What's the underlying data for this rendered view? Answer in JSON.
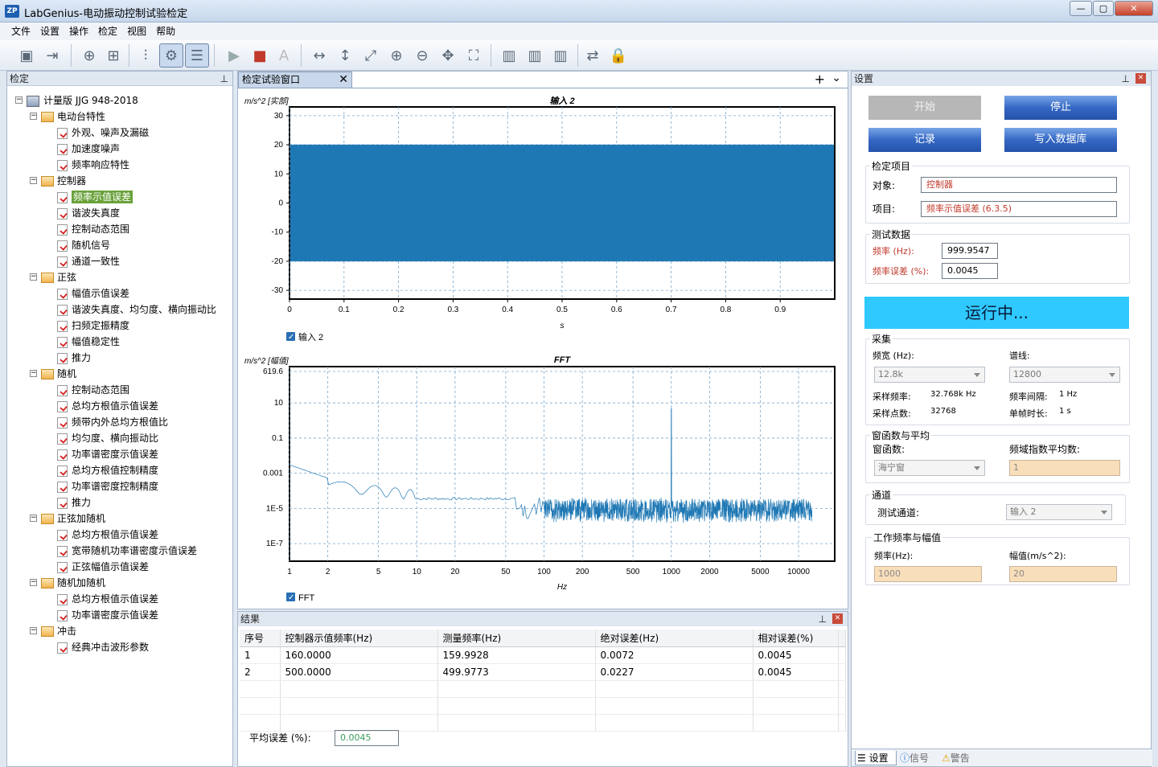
{
  "window": {
    "title": "LabGenius-电动振动控制试验检定",
    "logo": "ZP"
  },
  "menu": [
    "文件",
    "设置",
    "操作",
    "检定",
    "视图",
    "帮助"
  ],
  "left_panel": {
    "title": "检定",
    "root": "计量版 JJG 948-2018",
    "groups": [
      {
        "label": "电动台特性",
        "items": [
          "外观、噪声及漏磁",
          "加速度噪声",
          "频率响应特性"
        ]
      },
      {
        "label": "控制器",
        "items": [
          "频率示值误差",
          "谐波失真度",
          "控制动态范围",
          "随机信号",
          "通道一致性"
        ]
      },
      {
        "label": "正弦",
        "items": [
          "幅值示值误差",
          "谐波失真度、均匀度、横向振动比",
          "扫频定振精度",
          "幅值稳定性",
          "推力"
        ]
      },
      {
        "label": "随机",
        "items": [
          "控制动态范围",
          "总均方根值示值误差",
          "频带内外总均方根值比",
          "均匀度、横向振动比",
          "功率谱密度示值误差",
          "总均方根值控制精度",
          "功率谱密度控制精度",
          "推力"
        ]
      },
      {
        "label": "正弦加随机",
        "items": [
          "总均方根值示值误差",
          "宽带随机功率谱密度示值误差",
          "正弦幅值示值误差"
        ]
      },
      {
        "label": "随机加随机",
        "items": [
          "总均方根值示值误差",
          "功率谱密度示值误差"
        ]
      },
      {
        "label": "冲击",
        "items": [
          "经典冲击波形参数"
        ]
      }
    ],
    "selected": "频率示值误差"
  },
  "center": {
    "tab_label": "检定试验窗口",
    "add_symbol": "+",
    "menu_symbol": "⌄"
  },
  "chart_data": [
    {
      "type": "line",
      "title": "输入 2",
      "ylabel": "m/s^2 [实部]",
      "xlabel": "s",
      "xlim": [
        0,
        1
      ],
      "ylim": [
        -33,
        33
      ],
      "x_ticks": [
        "0",
        "0.1",
        "0.2",
        "0.3",
        "0.4",
        "0.5",
        "0.6",
        "0.7",
        "0.8",
        "0.9"
      ],
      "y_ticks": [
        "30",
        "20",
        "10",
        "0",
        "-10",
        "-20",
        "-30"
      ],
      "series": [
        {
          "name": "输入 2",
          "description_amplitude": 20,
          "frequency_hz": 160,
          "color": "#1f78b4"
        }
      ],
      "legend_checked": true
    },
    {
      "type": "line",
      "title": "FFT",
      "ylabel": "m/s^2 [幅值]",
      "xlabel": "Hz",
      "xscale": "log",
      "yscale": "log",
      "x_ticks": [
        "1",
        "2",
        "5",
        "10",
        "20",
        "50",
        "100",
        "200",
        "500",
        "1000",
        "2000",
        "5000",
        "10000"
      ],
      "y_ticks": [
        "619.6",
        "10",
        "0.1",
        "0.001",
        "1E-5",
        "1E-7"
      ],
      "series": [
        {
          "name": "FFT",
          "peak_hz": 1000,
          "color": "#1f78b4"
        }
      ],
      "legend_checked": true
    }
  ],
  "results": {
    "title": "结果",
    "columns": [
      "序号",
      "控制器示值频率(Hz)",
      "测量频率(Hz)",
      "绝对误差(Hz)",
      "相对误差(%)"
    ],
    "rows": [
      [
        "1",
        "160.0000",
        "159.9928",
        "0.0072",
        "0.0045"
      ],
      [
        "2",
        "500.0000",
        "499.9773",
        "0.0227",
        "0.0045"
      ]
    ],
    "avg_label": "平均误差 (%):",
    "avg_value": "0.0045"
  },
  "right_panel": {
    "title": "设置",
    "buttons": {
      "start": "开始",
      "stop": "停止",
      "record": "记录",
      "write_db": "写入数据库"
    },
    "verify": {
      "title": "检定项目",
      "object_label": "对象:",
      "object_value": "控制器",
      "item_label": "项目:",
      "item_value": "频率示值误差 (6.3.5)"
    },
    "test_data": {
      "title": "测试数据",
      "freq_label": "频率 (Hz):",
      "freq_value": "999.9547",
      "err_label": "频率误差 (%):",
      "err_value": "0.0045"
    },
    "status": "运行中...",
    "acq": {
      "title": "采集",
      "bw_label": "频宽 (Hz):",
      "bw_value": "12.8k",
      "lines_label": "谱线:",
      "lines_value": "12800",
      "sr_label": "采样频率:",
      "sr_value": "32.768k Hz",
      "fi_label": "频率间隔:",
      "fi_value": "1 Hz",
      "pts_label": "采样点数:",
      "pts_value": "32768",
      "frame_label": "单帧时长:",
      "frame_value": "1 s"
    },
    "window": {
      "title": "窗函数与平均",
      "win_label": "窗函数:",
      "win_value": "海宁窗",
      "avg_label": "频域指数平均数:",
      "avg_value": "1"
    },
    "channel": {
      "title": "通道",
      "label": "测试通道:",
      "value": "输入 2"
    },
    "work": {
      "title": "工作频率与幅值",
      "freq_label": "频率(Hz):",
      "freq_value": "1000",
      "amp_label": "幅值(m/s^2):",
      "amp_value": "20"
    },
    "tabs": [
      "设置",
      "信号",
      "警告"
    ]
  }
}
